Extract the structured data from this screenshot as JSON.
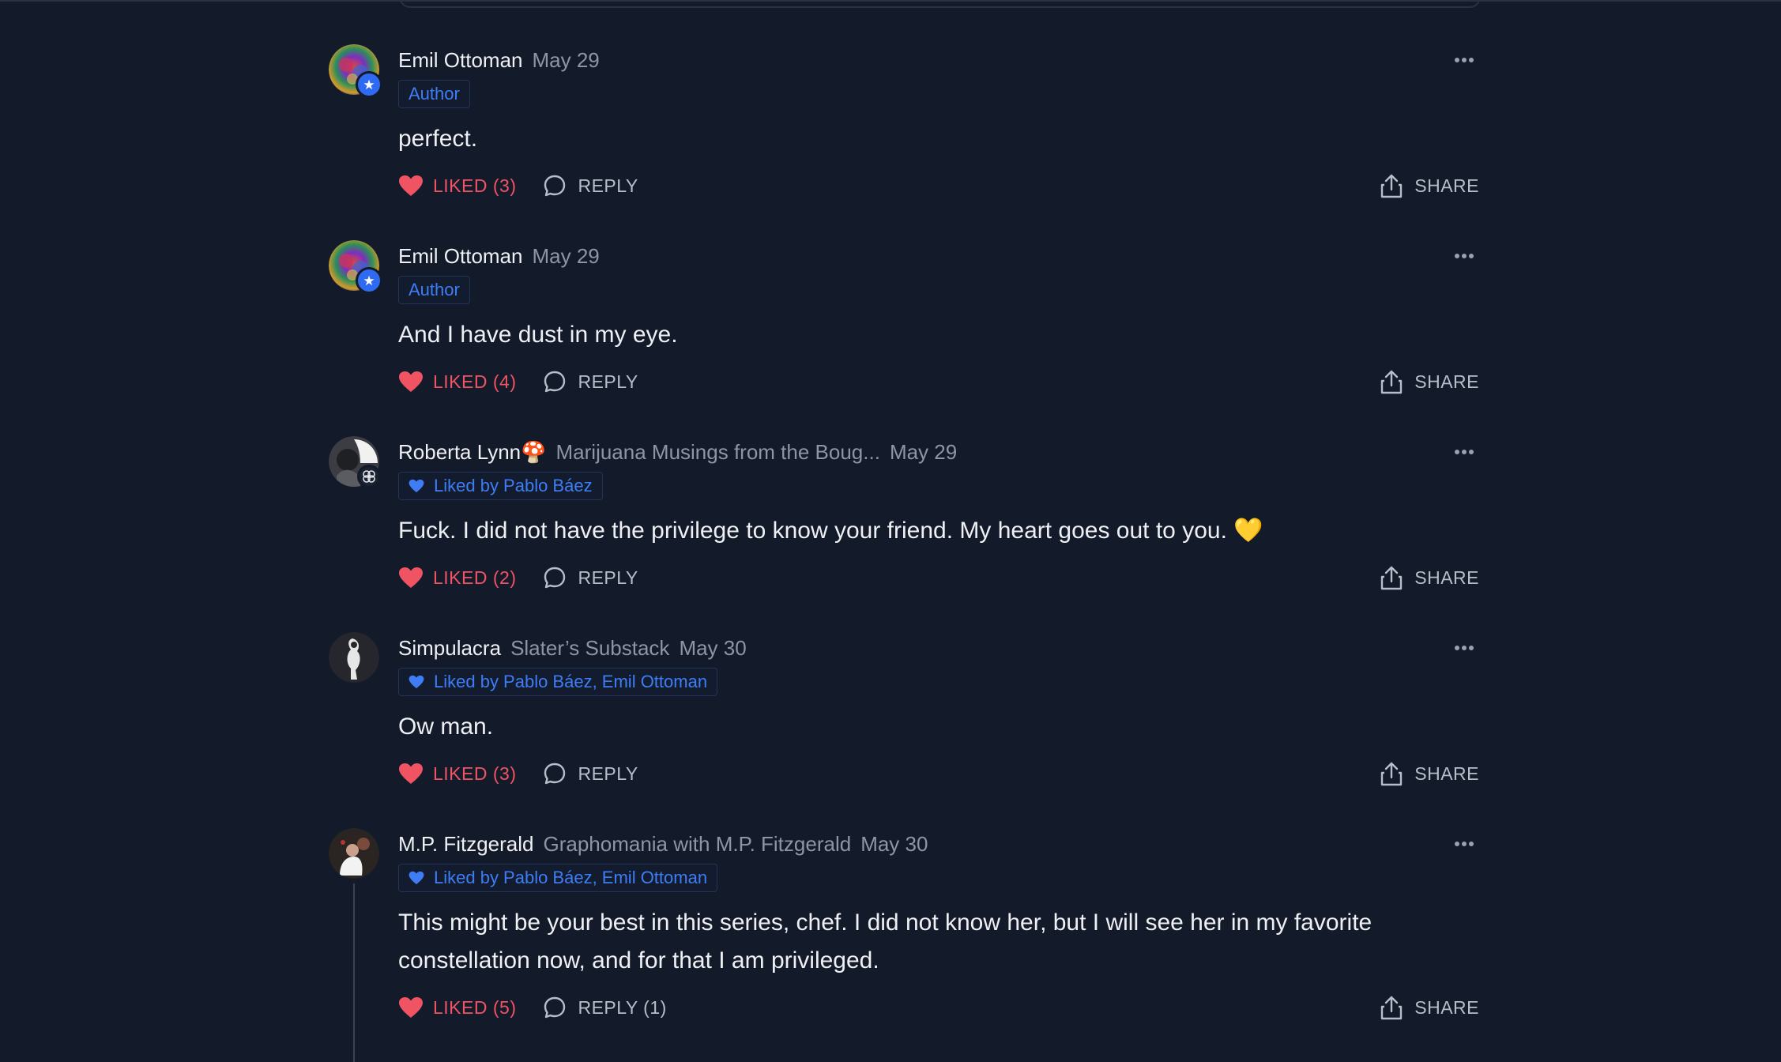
{
  "comments": [
    {
      "author": "Emil Ottoman",
      "publication": "",
      "date": "May 29",
      "tag": "Author",
      "body": "perfect.",
      "like_label": "LIKED (3)",
      "reply_label": "REPLY",
      "share_label": "SHARE"
    },
    {
      "author": "Emil Ottoman",
      "publication": "",
      "date": "May 29",
      "tag": "Author",
      "body": "And I have dust in my eye.",
      "like_label": "LIKED (4)",
      "reply_label": "REPLY",
      "share_label": "SHARE"
    },
    {
      "author": "Roberta Lynn🍄",
      "publication": "Marijuana Musings from the Boug...",
      "date": "May 29",
      "tag": "Liked by Pablo Báez",
      "body": "Fuck. I did not have the privilege to know your friend. My heart goes out to you. 💛",
      "like_label": "LIKED (2)",
      "reply_label": "REPLY",
      "share_label": "SHARE"
    },
    {
      "author": "Simpulacra",
      "publication": "Slater’s Substack",
      "date": "May 30",
      "tag": "Liked by Pablo Báez, Emil Ottoman",
      "body": "Ow man.",
      "like_label": "LIKED (3)",
      "reply_label": "REPLY",
      "share_label": "SHARE"
    },
    {
      "author": "M.P. Fitzgerald",
      "publication": "Graphomania with M.P. Fitzgerald",
      "date": "May 30",
      "tag": "Liked by Pablo Báez, Emil Ottoman",
      "body_line1": "This might be your best in this series, chef. I did not know her, but I will see her in my favorite",
      "body_line2": "constellation now, and for that I am privileged.",
      "like_label": "LIKED (5)",
      "reply_label": "REPLY (1)",
      "share_label": "SHARE"
    }
  ],
  "icons": {
    "more": "more-horizontal-icon",
    "heart": "heart-icon",
    "reply": "speech-bubble-icon",
    "share": "share-upload-icon",
    "author_badge": "star-icon",
    "pub_badge": "clover-icon"
  },
  "colors": {
    "background": "#131a29",
    "liked": "#f05463",
    "accent_blue": "#3e7df5",
    "muted": "#8e96a5",
    "text": "#eef0f4"
  }
}
